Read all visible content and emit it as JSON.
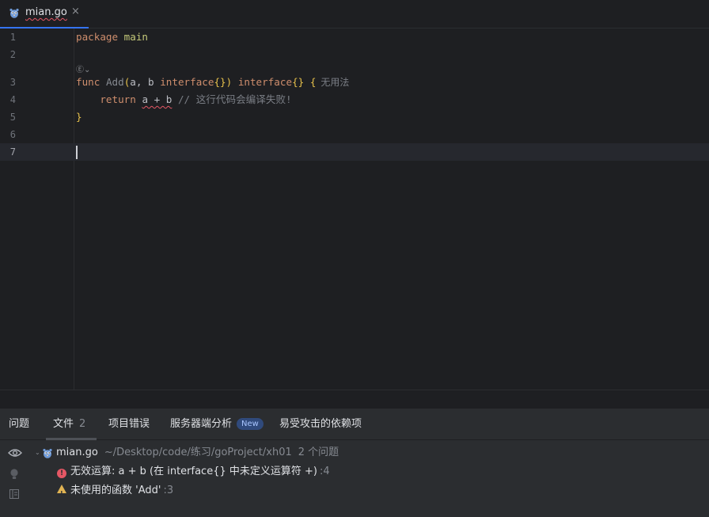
{
  "tab": {
    "file_name": "mian.go",
    "close_glyph": "×"
  },
  "editor": {
    "line_numbers": [
      "1",
      "2",
      "3",
      "4",
      "5",
      "6",
      "7"
    ],
    "line1": {
      "kw": "package",
      "name": "main"
    },
    "code_lens": "Ⓔ⌄",
    "line3": {
      "kw_func": "func",
      "fn_name": "Add",
      "open_paren": "(",
      "params": "a, b ",
      "param_type": "interface",
      "braces1": "{}",
      "close_paren": ")",
      "ret_type": "interface",
      "braces2": "{}",
      "open_brace": "{",
      "hint": "无用法"
    },
    "line4": {
      "kw_return": "return",
      "expr": "a + b",
      "comment": "// 这行代码会编译失败!"
    },
    "line5": {
      "close_brace": "}"
    }
  },
  "panel": {
    "tabs": {
      "problems": "问题",
      "file": "文件",
      "file_count": "2",
      "project_errors": "项目错误",
      "server_analysis": "服务器端分析",
      "new_badge": "New",
      "vulnerable_deps": "易受攻击的依赖项"
    },
    "file_row": {
      "name": "mian.go",
      "path": "~/Desktop/code/练习/goProject/xh01",
      "count": "2 个问题"
    },
    "problems": [
      {
        "severity": "error",
        "message": "无效运算: a + b (在 interface{} 中未定义运算符 +)",
        "line_ref": ":4"
      },
      {
        "severity": "warning",
        "message": "未使用的函数 'Add'",
        "line_ref": ":3"
      }
    ]
  },
  "colors": {
    "accent": "#3574f0",
    "error": "#e55765",
    "warning": "#e0b353",
    "keyword": "#cf8e6d"
  }
}
